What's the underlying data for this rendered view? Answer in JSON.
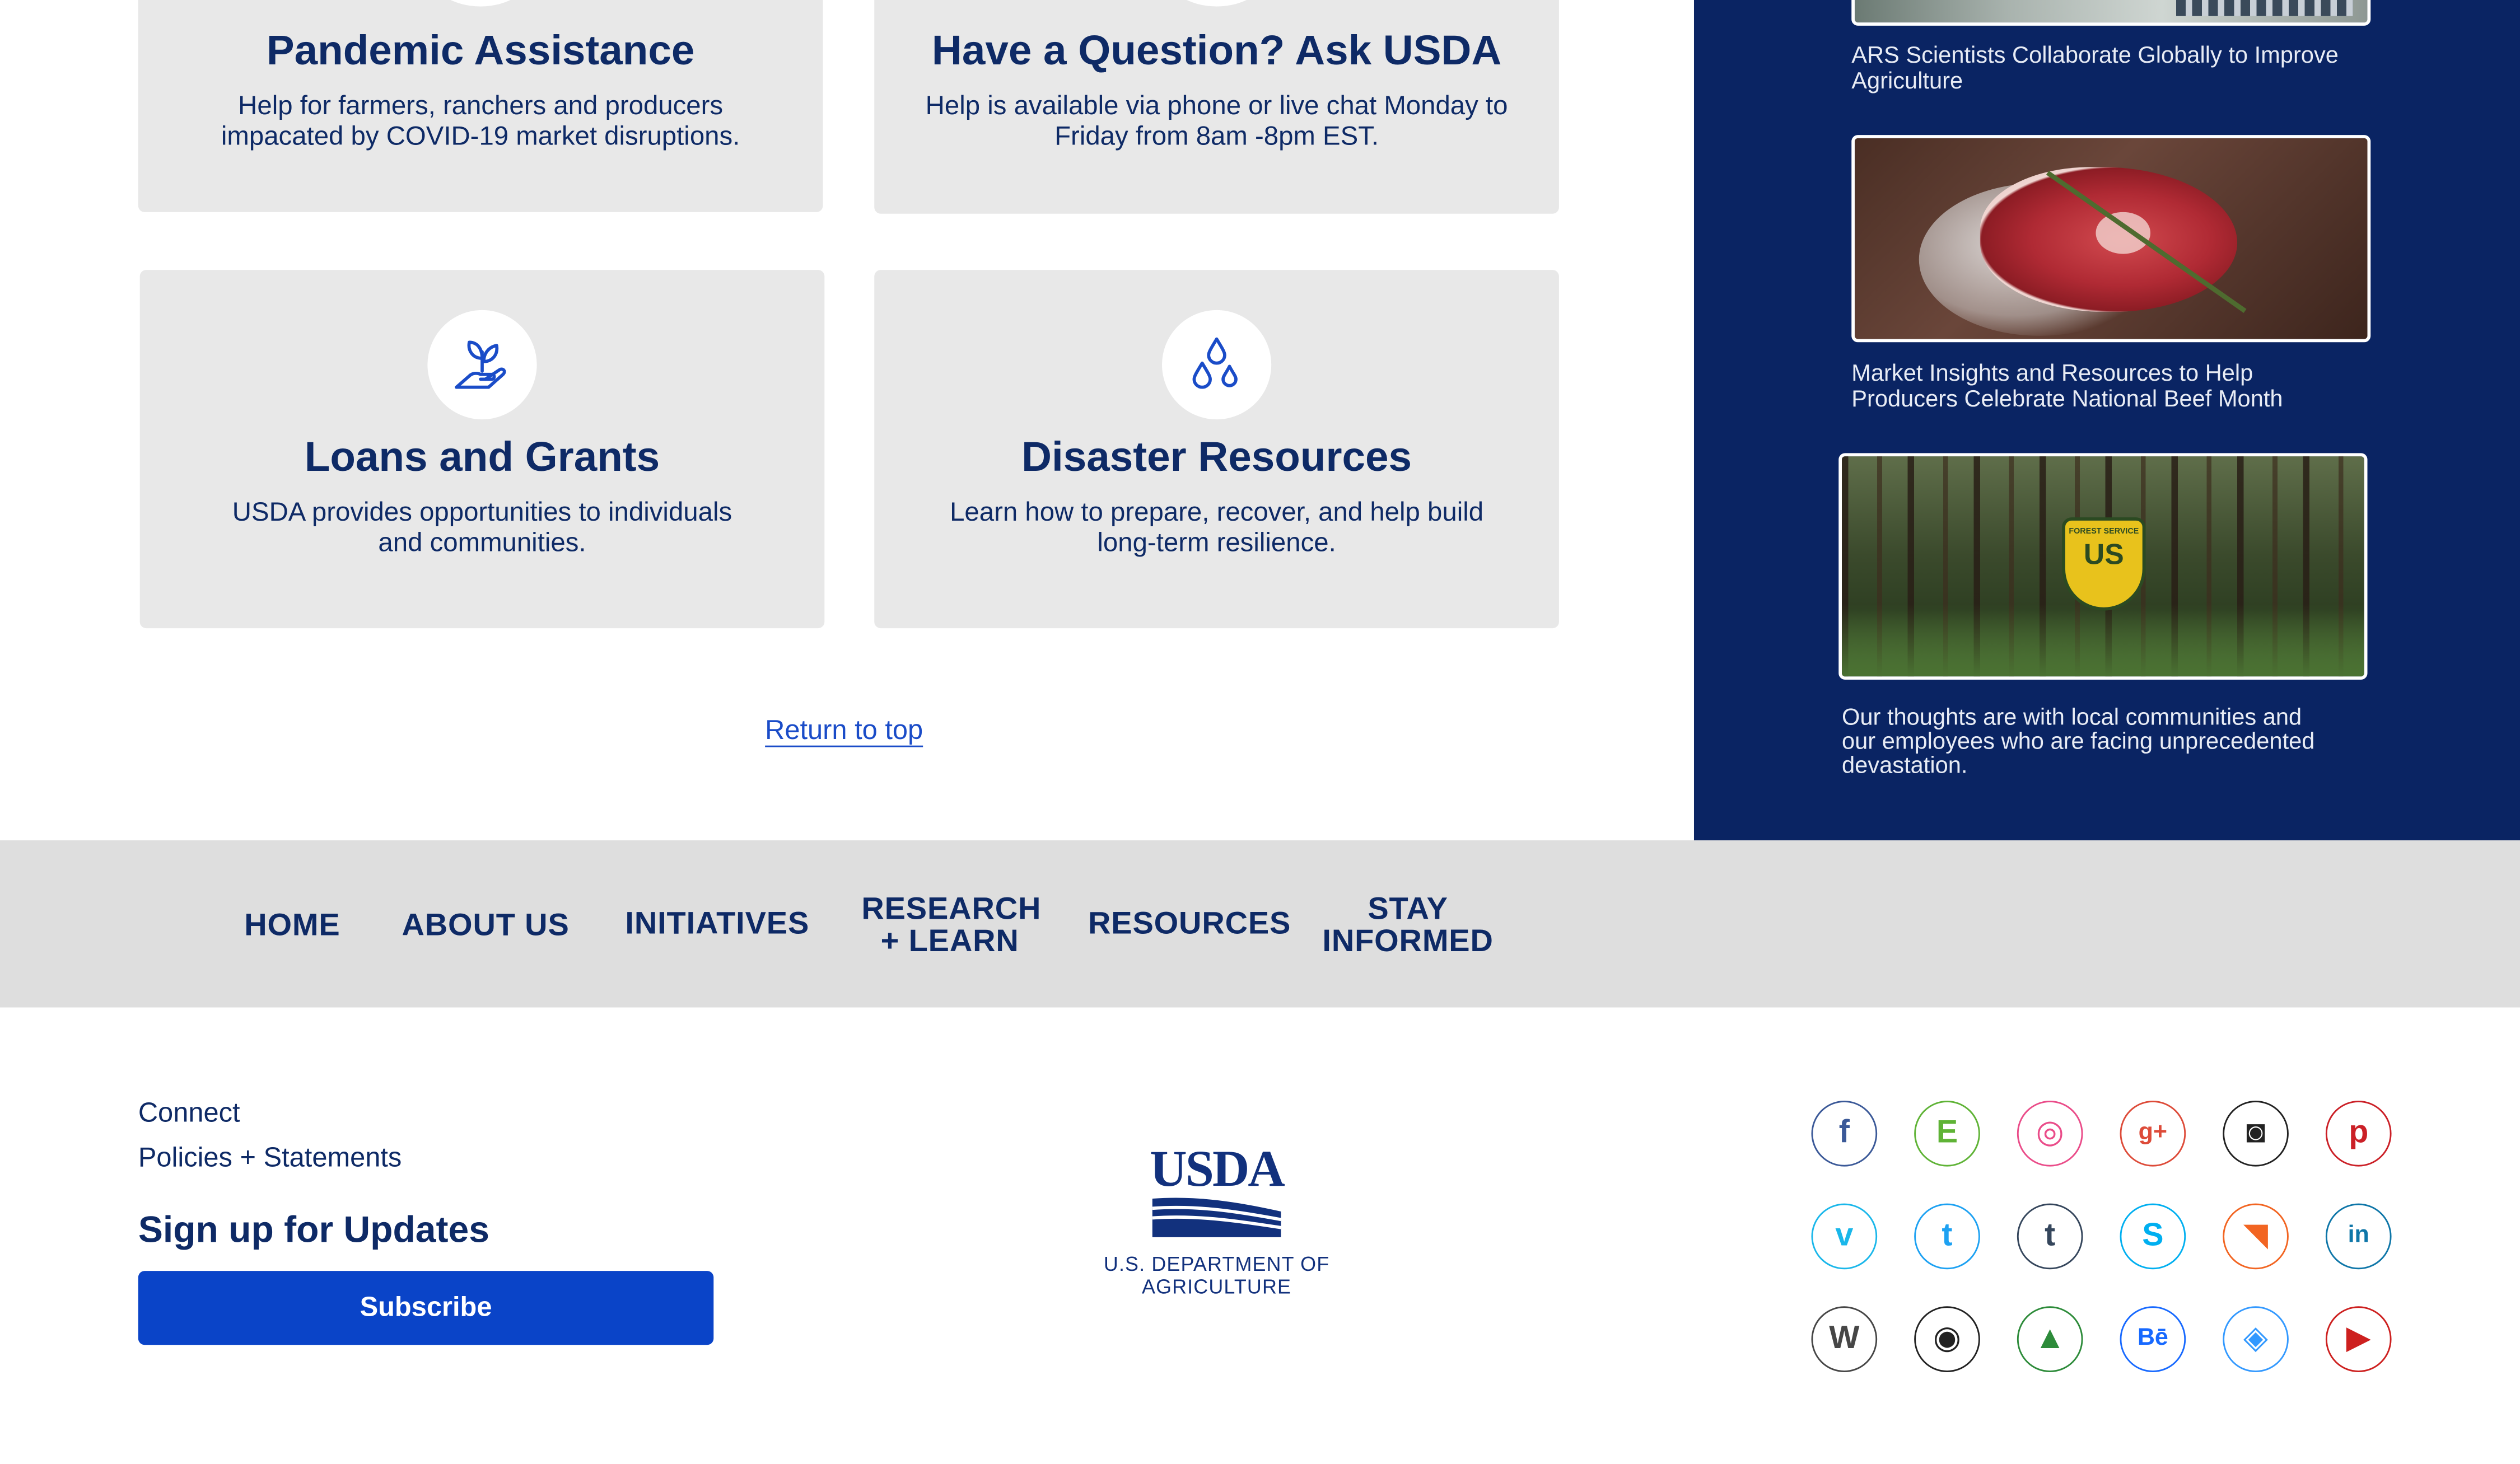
{
  "cards": [
    {
      "title": "Pandemic Assistance",
      "text_line1": "Help for farmers, ranchers and producers",
      "text_line2": "impacated by COVID-19 market disruptions."
    },
    {
      "title": "Have a Question? Ask USDA",
      "text_line1": "Help is available via phone or live chat Monday to",
      "text_line2": "Friday from 8am -8pm EST."
    },
    {
      "title": "Loans and Grants",
      "text_line1": "USDA provides opportunities to individuals",
      "text_line2": "and communities."
    },
    {
      "title": "Disaster Resources",
      "text_line1": "Learn how to prepare, recover, and help build",
      "text_line2": "long-term resilience."
    }
  ],
  "return_to_top": "Return to top",
  "sidebar": {
    "items": [
      {
        "caption_line1": "ARS Scientists Collaborate Globally to Improve",
        "caption_line2": "Agriculture"
      },
      {
        "caption_line1": "Market Insights and Resources to Help",
        "caption_line2": "Producers Celebrate National Beef Month"
      },
      {
        "caption_line1": "Our thoughts are with local communities and",
        "caption_line2": "our employees who are facing unprecedented",
        "caption_line3": "devastation."
      }
    ],
    "forest_badge_text": "FOREST SERVICE",
    "forest_badge_letters": "US"
  },
  "nav": {
    "home": "HOME",
    "about": "ABOUT US",
    "initiatives": "INITIATIVES",
    "research_line1": "RESEARCH",
    "research_line2": "+ LEARN",
    "resources": "RESOURCES",
    "stay_line1": "STAY",
    "stay_line2": "INFORMED"
  },
  "footer": {
    "connect": "Connect",
    "policies": "Policies + Statements",
    "signup_heading": "Sign up for Updates",
    "subscribe": "Subscribe",
    "logo_text": "USDA",
    "department": "U.S. DEPARTMENT OF AGRICULTURE"
  },
  "social": [
    {
      "name": "facebook-icon",
      "glyph": "f",
      "color": "#3b5998"
    },
    {
      "name": "evernote-icon",
      "glyph": "E",
      "color": "#5fb336"
    },
    {
      "name": "dribbble-icon",
      "glyph": "◎",
      "color": "#ea4c89"
    },
    {
      "name": "google-plus-icon",
      "glyph": "g+",
      "color": "#dd4b39"
    },
    {
      "name": "instagram-icon",
      "glyph": "◙",
      "color": "#222222"
    },
    {
      "name": "pinterest-icon",
      "glyph": "p",
      "color": "#cb2027"
    },
    {
      "name": "vimeo-icon",
      "glyph": "v",
      "color": "#1ab7ea"
    },
    {
      "name": "twitter-icon",
      "glyph": "t",
      "color": "#1da1f2"
    },
    {
      "name": "tumblr-icon",
      "glyph": "t",
      "color": "#35465c"
    },
    {
      "name": "skype-icon",
      "glyph": "S",
      "color": "#00aff0"
    },
    {
      "name": "rss-icon",
      "glyph": "◥",
      "color": "#f26522"
    },
    {
      "name": "linkedin-icon",
      "glyph": "in",
      "color": "#0e76a8"
    },
    {
      "name": "wordpress-icon",
      "glyph": "W",
      "color": "#464646"
    },
    {
      "name": "github-icon",
      "glyph": "◉",
      "color": "#222222"
    },
    {
      "name": "forrst-icon",
      "glyph": "▲",
      "color": "#2d8b3a"
    },
    {
      "name": "behance-icon",
      "glyph": "Bē",
      "color": "#1769ff"
    },
    {
      "name": "delicious-icon",
      "glyph": "◈",
      "color": "#3399ff"
    },
    {
      "name": "youtube-icon",
      "glyph": "▶",
      "color": "#cd201f"
    }
  ]
}
